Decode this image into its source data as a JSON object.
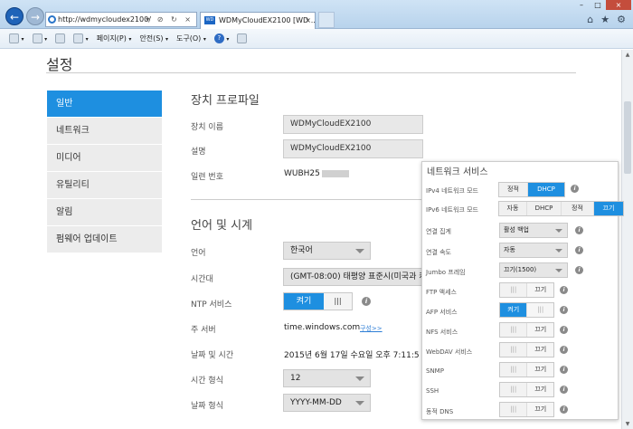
{
  "browser": {
    "address": "http://wdmycloudex2100/",
    "address_controls": "▾ ⊘ ↻ ×",
    "tab_title": "WDMyCloudEX2100 [WD ...",
    "tab_icon_text": "WD",
    "win_min": "–",
    "win_max": "□",
    "win_close": "×",
    "back_glyph": "←",
    "fwd_glyph": "→",
    "tab_close": "×",
    "icons": {
      "home": "⌂",
      "star": "★",
      "gear": "⚙"
    }
  },
  "commandbar": {
    "page": "페이지(P)",
    "safety": "안전(S)",
    "tools": "도구(O)",
    "help_glyph": "?",
    "caret": "▾"
  },
  "page": {
    "title": "설정",
    "nav": [
      "일반",
      "네트워크",
      "미디어",
      "유틸리티",
      "알림",
      "펌웨어 업데이트"
    ],
    "device_profile": {
      "heading": "장치 프로파일",
      "name_label": "장치 이름",
      "name_value": "WDMyCloudEX2100",
      "desc_label": "설명",
      "desc_value": "WDMyCloudEX2100",
      "serial_label": "일련 번호",
      "serial_value": "WUBH25"
    },
    "lang_time": {
      "heading": "언어 및 시계",
      "lang_label": "언어",
      "lang_value": "한국어",
      "tz_label": "시간대",
      "tz_value": "(GMT-08:00) 태평양 표준시(미국과 캐",
      "ntp_label": "NTP 서비스",
      "ntp_on": "켜기",
      "ntp_off": "|||",
      "server_label": "주 서버",
      "server_value": "time.windows.com",
      "server_link": "구성>>",
      "datetime_label": "날짜 및 시간",
      "datetime_value": "2015년 6월 17일 수요일 오후 7:11:5",
      "timefmt_label": "시간 형식",
      "timefmt_value": "12",
      "datefmt_label": "날짜 형식",
      "datefmt_value": "YYYY-MM-DD"
    }
  },
  "network_panel": {
    "title": "네트워크 서비스",
    "info_glyph": "i",
    "ipv4_label": "IPv4 네트워크 모드",
    "ipv4_options": [
      "정적",
      "DHCP"
    ],
    "ipv4_selected": "DHCP",
    "ipv6_label": "IPv6 네트워크 모드",
    "ipv6_options": [
      "자동",
      "DHCP",
      "정적",
      "끄기"
    ],
    "ipv6_selected": "끄기",
    "link_agg_label": "연결 집계",
    "link_agg_value": "활성 백업",
    "link_speed_label": "연결 속도",
    "link_speed_value": "자동",
    "jumbo_label": "Jumbo 프레임",
    "jumbo_value": "끄기(1500)",
    "services": [
      {
        "label": "FTP 액세스",
        "state": "끄기",
        "bars": "|||"
      },
      {
        "label": "AFP 서비스",
        "state": "켜기",
        "bars": "|||"
      },
      {
        "label": "NFS 서비스",
        "state": "끄기",
        "bars": "|||"
      },
      {
        "label": "WebDAV 서비스",
        "state": "끄기",
        "bars": "|||"
      },
      {
        "label": "SNMP",
        "state": "끄기",
        "bars": "|||"
      },
      {
        "label": "SSH",
        "state": "끄기",
        "bars": "|||"
      },
      {
        "label": "동적 DNS",
        "state": "끄기",
        "bars": "|||"
      }
    ]
  },
  "colors": {
    "accent": "#1e8fe0",
    "nav_bg": "#ececec",
    "titlebar": "#cfe3f5"
  }
}
